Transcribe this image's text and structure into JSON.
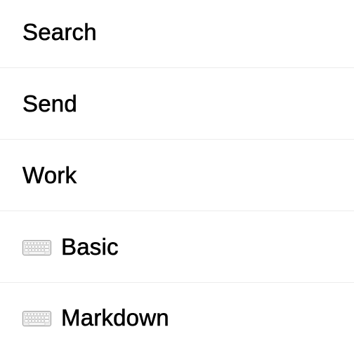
{
  "list": {
    "items": [
      {
        "label": "Search",
        "icon": null
      },
      {
        "label": "Send",
        "icon": null
      },
      {
        "label": "Work",
        "icon": null
      },
      {
        "label": "Basic",
        "icon": "keyboard-icon"
      },
      {
        "label": "Markdown",
        "icon": "keyboard-icon"
      }
    ]
  }
}
